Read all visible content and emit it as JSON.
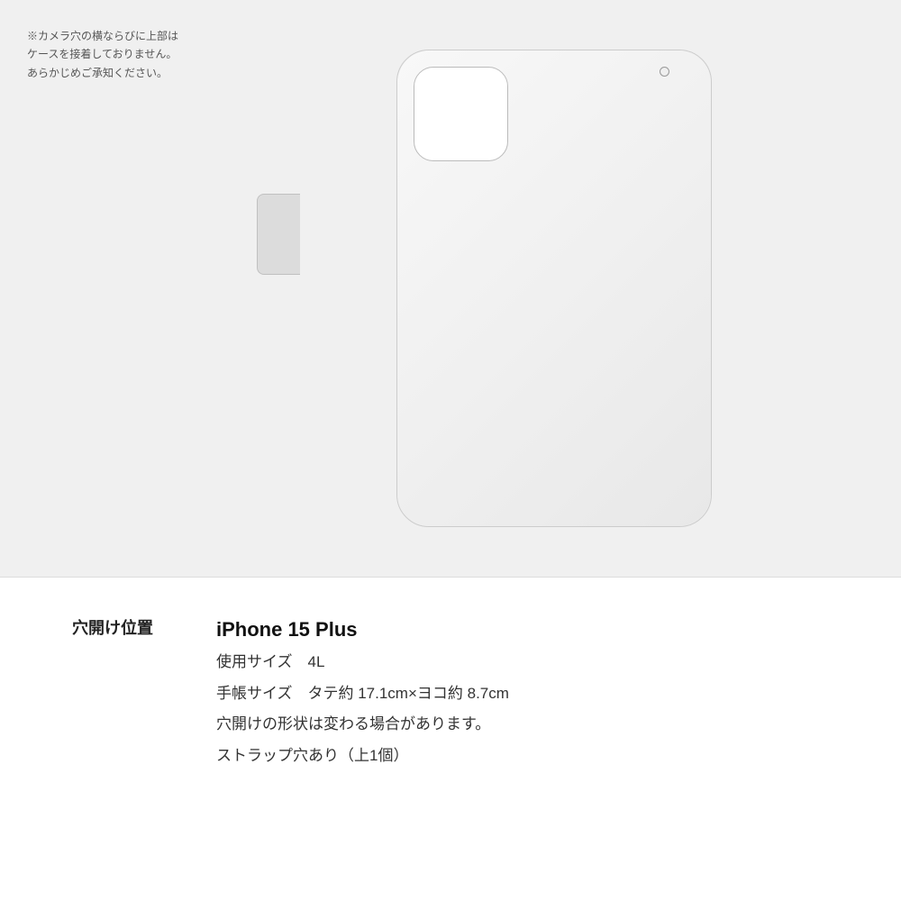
{
  "note": {
    "text": "※カメラ穴の横ならびに上部は\nケースを接着しておりません。\nあらかじめご承知ください。"
  },
  "info": {
    "label": "穴開け位置",
    "device_name": "iPhone 15 Plus",
    "size_label": "使用サイズ　4L",
    "dimensions_label": "手帳サイズ　タテ約 17.1cm×ヨコ約 8.7cm",
    "shape_note": "穴開けの形状は変わる場合があります。",
    "strap_note": "ストラップ穴あり（上1個）"
  },
  "colors": {
    "case_bg": "#efefef",
    "page_bg": "#f0f0f0",
    "info_bg": "#ffffff",
    "border": "#cccccc",
    "text_dark": "#111111",
    "text_mid": "#333333",
    "text_light": "#555555"
  }
}
